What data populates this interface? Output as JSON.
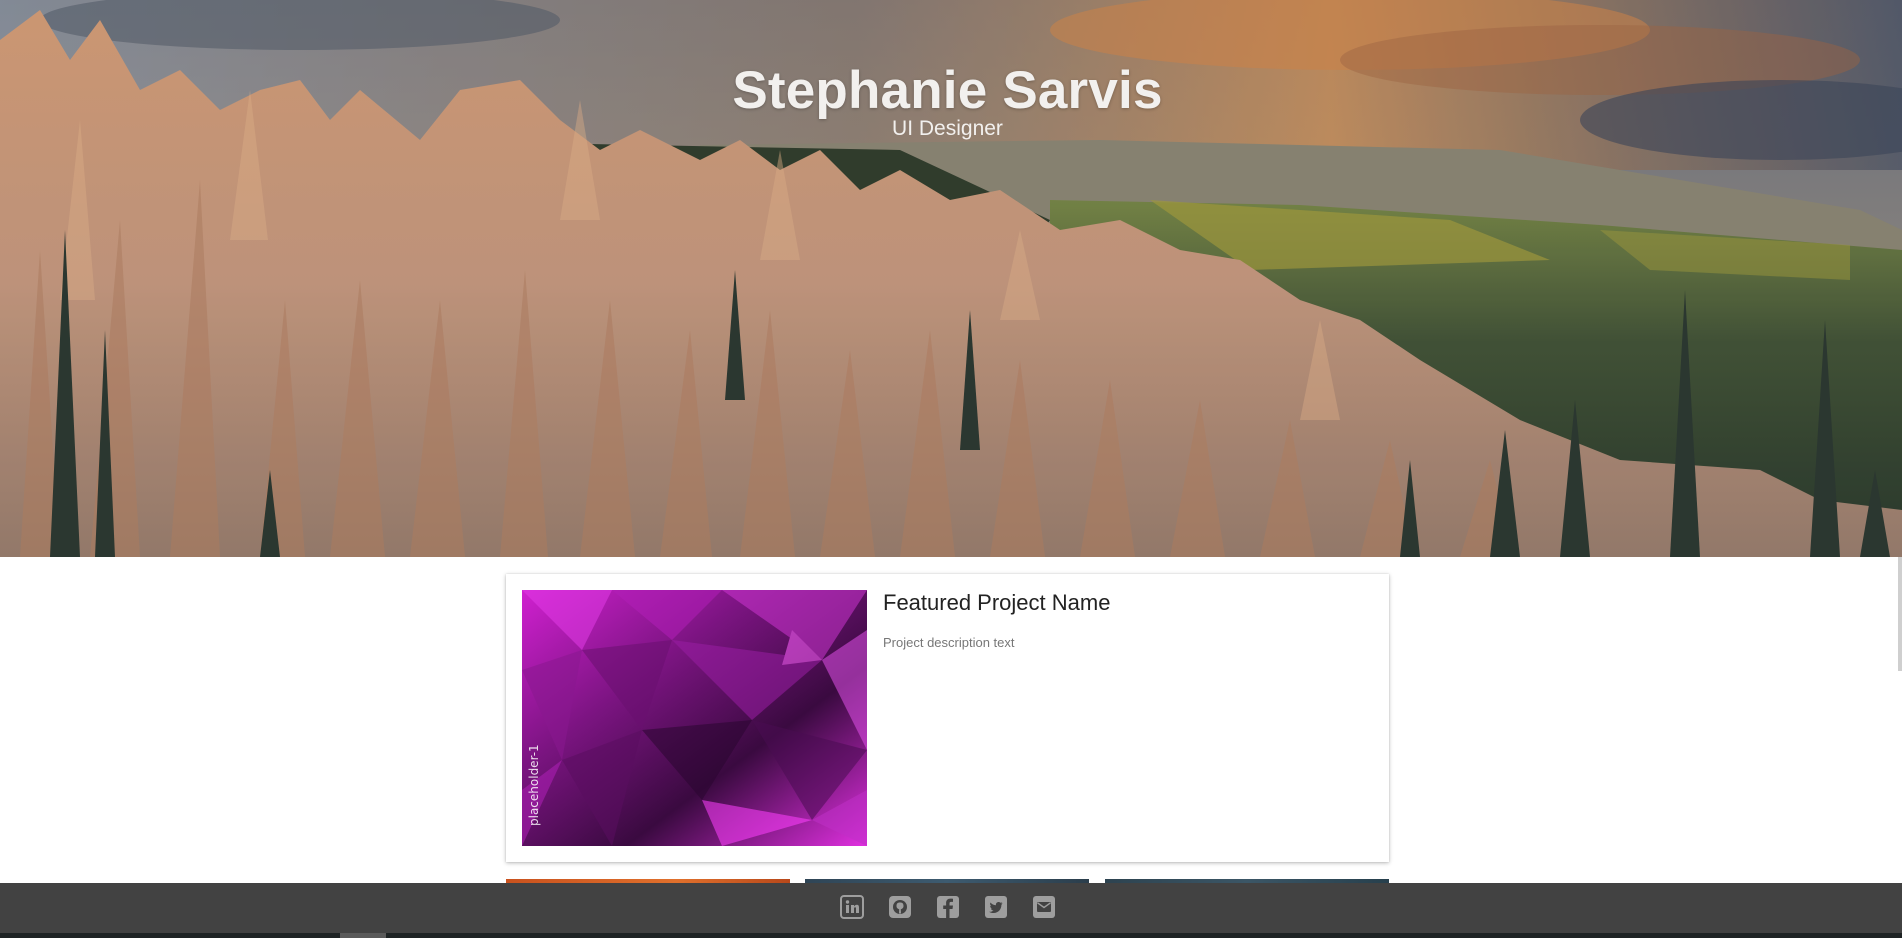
{
  "hero": {
    "title": "Stephanie Sarvis",
    "subtitle": "UI Designer",
    "image_description": "panoramic landscape of rock hoodoos and forest under a cloudy sunset sky"
  },
  "featured_project": {
    "title": "Featured Project Name",
    "description": "Project description text",
    "image_label": "placeholder-1"
  },
  "footer": {
    "social_icons": [
      "linkedin-icon",
      "github-icon",
      "facebook-icon",
      "twitter-icon",
      "email-icon"
    ]
  },
  "colors": {
    "footer_bg": "#424242",
    "icon_color": "#9e9e9e",
    "hero_text": "#f2f0ee",
    "card_bg": "#ffffff"
  }
}
